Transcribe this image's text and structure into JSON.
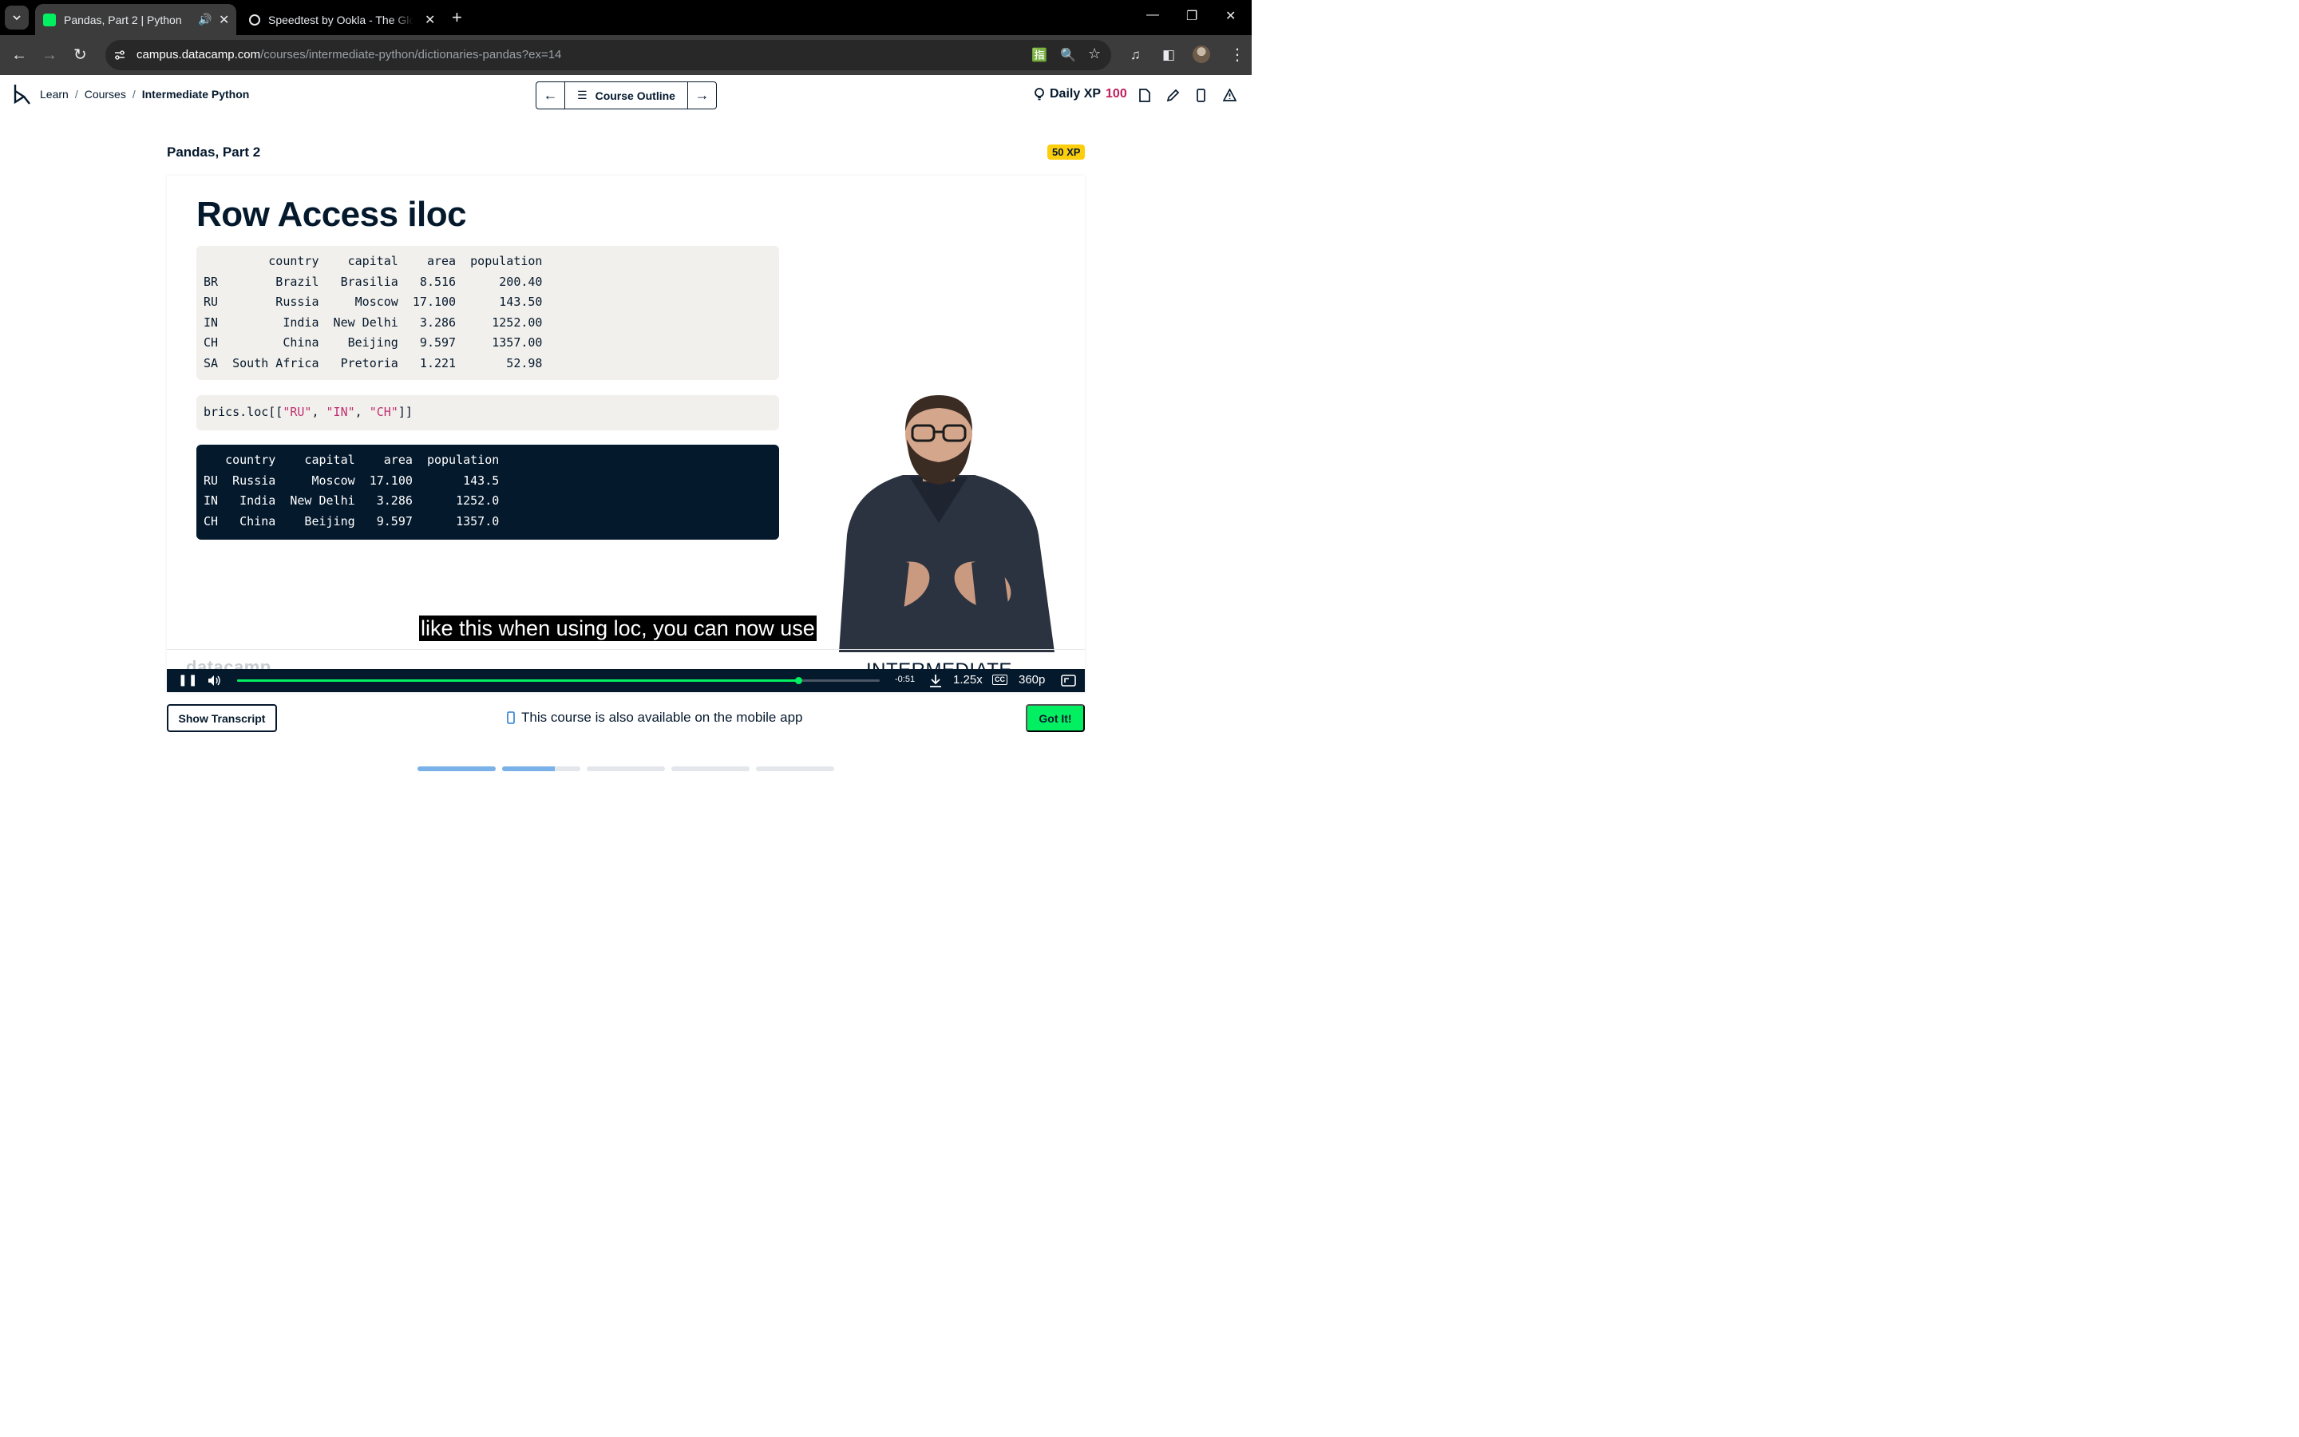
{
  "browser": {
    "tabs": [
      {
        "title": "Pandas, Part 2 | Python",
        "active": true
      },
      {
        "title": "Speedtest by Ookla - The Global Broadband Speed Test",
        "active": false
      }
    ],
    "url_host": "campus.datacamp.com",
    "url_path": "/courses/intermediate-python/dictionaries-pandas?ex=14"
  },
  "header": {
    "breadcrumbs": [
      "Learn",
      "Courses",
      "Intermediate Python"
    ],
    "separator": "/",
    "course_outline_label": "Course Outline",
    "daily_xp_label": "Daily XP",
    "daily_xp_value": "100"
  },
  "lesson": {
    "title": "Pandas, Part 2",
    "xp_badge": "50 XP"
  },
  "slide": {
    "title": "Row Access iloc",
    "table1": [
      "         country    capital    area  population",
      "BR        Brazil   Brasilia   8.516      200.40",
      "RU        Russia     Moscow  17.100      143.50",
      "IN         India  New Delhi   3.286     1252.00",
      "CH         China    Beijing   9.597     1357.00",
      "SA  South Africa   Pretoria   1.221       52.98"
    ],
    "code_prefix": "brics.loc[[",
    "code_args": [
      "\"RU\"",
      "\"IN\"",
      "\"CH\""
    ],
    "code_suffix": "]]",
    "table2": [
      "   country    capital    area  population",
      "RU  Russia     Moscow  17.100       143.5",
      "IN   India  New Delhi   3.286      1252.0",
      "CH   China    Beijing   9.597      1357.0"
    ],
    "footer_logo": "datacamp",
    "footer_course": "INTERMEDIATE PYTHON"
  },
  "video": {
    "caption": "like this when using loc, you can now use",
    "progress": 0.873,
    "time_remaining": "-0:51",
    "speed": "1.25x",
    "quality": "360p"
  },
  "below": {
    "transcript_button": "Show Transcript",
    "mobile_note": "This course is also available on the mobile app",
    "got_it_button": "Got It!",
    "steps": [
      1,
      0.67,
      0,
      0,
      0
    ]
  },
  "colors": {
    "navy": "#05192d",
    "green": "#03ef62",
    "xp_pink": "#c01c58",
    "badge_yellow": "#fcce0d",
    "string_pink": "#bf3072",
    "step_blue": "#7ab1e9"
  }
}
